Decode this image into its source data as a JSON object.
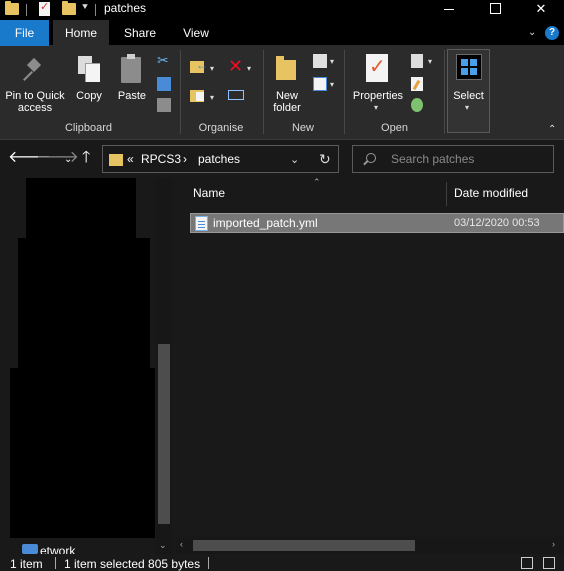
{
  "window": {
    "title": "patches",
    "minimize": "—",
    "maximize": "☐",
    "close": "✕"
  },
  "ribbon_tabs": [
    "File",
    "Home",
    "Share",
    "View"
  ],
  "ribbon": {
    "clipboard": {
      "label": "Clipboard",
      "pin_line1": "Pin to Quick",
      "pin_line2": "access",
      "copy": "Copy",
      "paste": "Paste"
    },
    "organise": {
      "label": "Organise"
    },
    "new": {
      "label": "New",
      "folder_line1": "New",
      "folder_line2": "folder"
    },
    "open": {
      "label": "Open",
      "properties": "Properties"
    },
    "select": {
      "label": "Select"
    }
  },
  "address": {
    "overflow": "«",
    "crumbs": [
      "RPCS3",
      "patches"
    ],
    "separator": "›"
  },
  "search": {
    "placeholder": "Search patches"
  },
  "nav_pane": {
    "last_item_partial": "etwork"
  },
  "columns": {
    "name": "Name",
    "date": "Date modified"
  },
  "files": [
    {
      "name": "imported_patch.yml",
      "date": "03/12/2020 00:53",
      "selected": true
    }
  ],
  "status": {
    "items": "1 item",
    "selection": "1 item selected  805 bytes"
  },
  "colors": {
    "accent": "#1979ca",
    "folder": "#e8c361",
    "selection": "#777777"
  }
}
